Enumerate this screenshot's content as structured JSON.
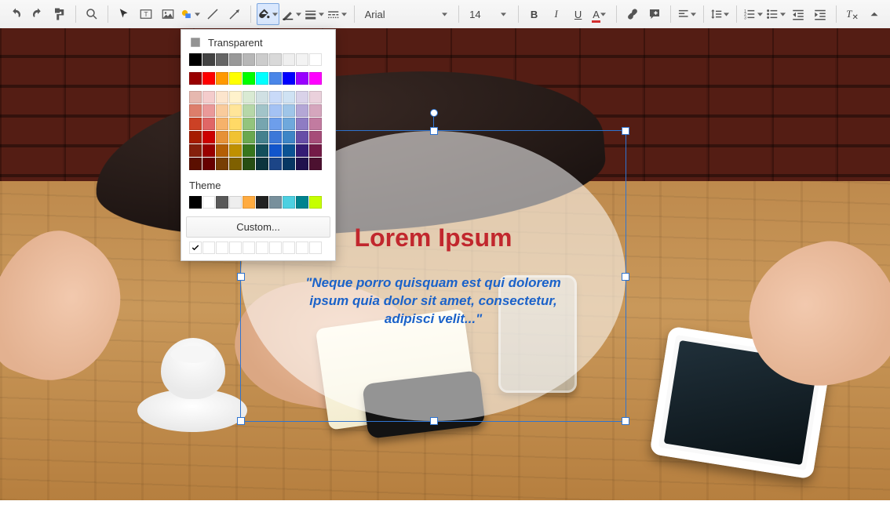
{
  "toolbar": {
    "font": "Arial",
    "size": "14"
  },
  "popup": {
    "transparent_label": "Transparent",
    "theme_label": "Theme",
    "custom_label": "Custom...",
    "grays": [
      "#000000",
      "#434343",
      "#666666",
      "#999999",
      "#b7b7b7",
      "#cccccc",
      "#d9d9d9",
      "#efefef",
      "#f3f3f3",
      "#ffffff"
    ],
    "main_row": [
      "#980000",
      "#ff0000",
      "#ff9900",
      "#ffff00",
      "#00ff00",
      "#00ffff",
      "#4a86e8",
      "#0000ff",
      "#9900ff",
      "#ff00ff"
    ],
    "shades": [
      [
        "#e6b8af",
        "#f4cccc",
        "#fce5cd",
        "#fff2cc",
        "#d9ead3",
        "#d0e0e3",
        "#c9daf8",
        "#cfe2f3",
        "#d9d2e9",
        "#ead1dc"
      ],
      [
        "#dd7e6b",
        "#ea9999",
        "#f9cb9c",
        "#ffe599",
        "#b6d7a8",
        "#a2c4c9",
        "#a4c2f4",
        "#9fc5e8",
        "#b4a7d6",
        "#d5a6bd"
      ],
      [
        "#cc4125",
        "#e06666",
        "#f6b26b",
        "#ffd966",
        "#93c47d",
        "#76a5af",
        "#6d9eeb",
        "#6fa8dc",
        "#8e7cc3",
        "#c27ba0"
      ],
      [
        "#a61c00",
        "#cc0000",
        "#e69138",
        "#f1c232",
        "#6aa84f",
        "#45818e",
        "#3c78d8",
        "#3d85c6",
        "#674ea7",
        "#a64d79"
      ],
      [
        "#85200c",
        "#990000",
        "#b45f06",
        "#bf9000",
        "#38761d",
        "#134f5c",
        "#1155cc",
        "#0b5394",
        "#351c75",
        "#741b47"
      ],
      [
        "#5b0f00",
        "#660000",
        "#783f04",
        "#7f6000",
        "#274e13",
        "#0c343d",
        "#1c4587",
        "#073763",
        "#20124d",
        "#4c1130"
      ]
    ],
    "theme_colors": [
      "#000000",
      "#ffffff",
      "#595959",
      "#eeeeee",
      "#ffab40",
      "#212121",
      "#78909c",
      "#4dd0e1",
      "#00838f",
      "#c6ff00"
    ]
  },
  "canvas": {
    "title": "Lorem Ipsum",
    "quote": "\"Neque porro quisquam est qui dolorem ipsum quia dolor sit amet, consectetur, adipisci velit...\""
  }
}
